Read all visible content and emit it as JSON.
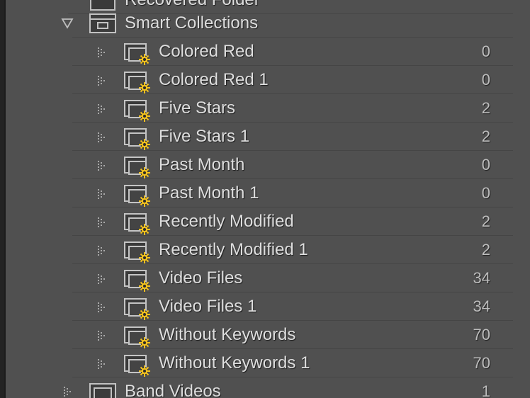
{
  "top_item": {
    "label": "Recovered Folder"
  },
  "smart_collections": {
    "label": "Smart Collections",
    "items": [
      {
        "label": "Colored Red",
        "count": "0"
      },
      {
        "label": "Colored Red 1",
        "count": "0"
      },
      {
        "label": "Five Stars",
        "count": "2"
      },
      {
        "label": "Five Stars 1",
        "count": "2"
      },
      {
        "label": "Past Month",
        "count": "0"
      },
      {
        "label": "Past Month 1",
        "count": "0"
      },
      {
        "label": "Recently Modified",
        "count": "2"
      },
      {
        "label": "Recently Modified 1",
        "count": "2"
      },
      {
        "label": "Video Files",
        "count": "34"
      },
      {
        "label": "Video Files 1",
        "count": "34"
      },
      {
        "label": "Without Keywords",
        "count": "70"
      },
      {
        "label": "Without Keywords 1",
        "count": "70"
      }
    ]
  },
  "bottom_item": {
    "label": "Band Videos",
    "count": "1"
  },
  "colors": {
    "panel": "#505050",
    "text": "#dedede",
    "count": "#bdbdbd",
    "gear": "#f0c020"
  }
}
